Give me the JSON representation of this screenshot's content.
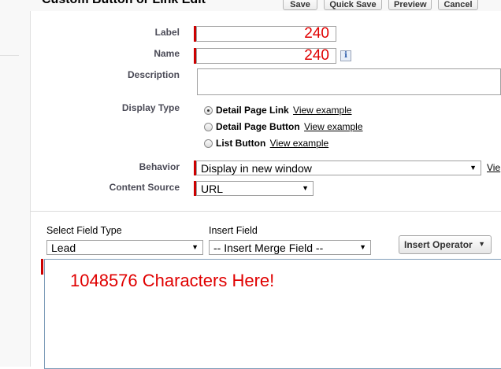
{
  "header": {
    "title": "Custom Button or Link Edit",
    "buttons": {
      "save": "Save",
      "quick_save": "Quick Save",
      "preview": "Preview",
      "cancel": "Cancel"
    }
  },
  "form": {
    "label": {
      "label": "Label",
      "value": "240"
    },
    "name": {
      "label": "Name",
      "value": "240",
      "info_icon": "info-icon"
    },
    "description": {
      "label": "Description",
      "value": ""
    },
    "display_type": {
      "label": "Display Type",
      "options": [
        {
          "label": "Detail Page Link",
          "link": "View example",
          "checked": true
        },
        {
          "label": "Detail Page Button",
          "link": "View example",
          "checked": false
        },
        {
          "label": "List Button",
          "link": "View example",
          "checked": false
        }
      ]
    },
    "behavior": {
      "label": "Behavior",
      "value": "Display in new window",
      "side_link": "Vie"
    },
    "content_source": {
      "label": "Content Source",
      "value": "URL"
    }
  },
  "formula": {
    "field_type": {
      "label": "Select Field Type",
      "value": "Lead"
    },
    "insert_field": {
      "label": "Insert Field",
      "value": "-- Insert Merge Field --"
    },
    "insert_operator": {
      "label": "Insert Operator"
    },
    "editor_text": "1048576 Characters Here!"
  },
  "colors": {
    "required": "#cc0000",
    "annotation_red": "#e00000"
  }
}
